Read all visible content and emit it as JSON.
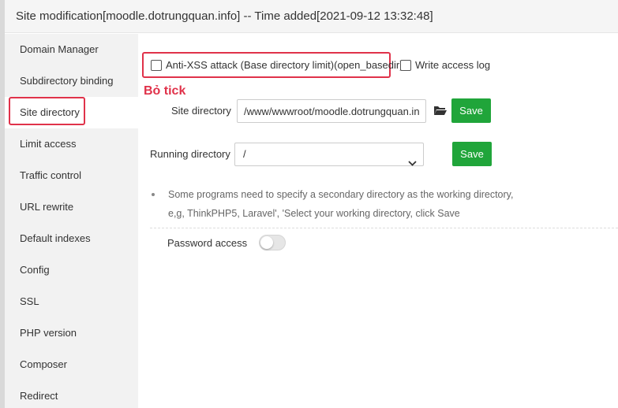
{
  "dialog": {
    "title": "Site modification[moodle.dotrungquan.info] -- Time added[2021-09-12 13:32:48]"
  },
  "sidebar": {
    "items": [
      {
        "label": "Domain Manager"
      },
      {
        "label": "Subdirectory binding"
      },
      {
        "label": "Site directory"
      },
      {
        "label": "Limit access"
      },
      {
        "label": "Traffic control"
      },
      {
        "label": "URL rewrite"
      },
      {
        "label": "Default indexes"
      },
      {
        "label": "Config"
      },
      {
        "label": "SSL"
      },
      {
        "label": "PHP version"
      },
      {
        "label": "Composer"
      },
      {
        "label": "Redirect"
      }
    ],
    "active_index": 2
  },
  "annotation": {
    "text": "Bỏ tick"
  },
  "options": {
    "anti_xss_label": "Anti-XSS attack (Base directory limit)(open_basedir)",
    "anti_xss_checked": false,
    "write_log_label": "Write access log",
    "write_log_checked": false
  },
  "site_directory": {
    "label": "Site directory",
    "value": "/www/wwwroot/moodle.dotrungquan.info",
    "save_label": "Save"
  },
  "running_directory": {
    "label": "Running directory",
    "selected": "/",
    "save_label": "Save"
  },
  "notes": {
    "line1": "Some programs need to specify a secondary directory as the working directory,",
    "line2": "e,g, ThinkPHP5, Laravel', 'Select your working directory, click Save"
  },
  "password_access": {
    "label": "Password access",
    "enabled": false
  },
  "colors": {
    "accent_green": "#20a53a",
    "highlight_red": "#e0324a"
  }
}
